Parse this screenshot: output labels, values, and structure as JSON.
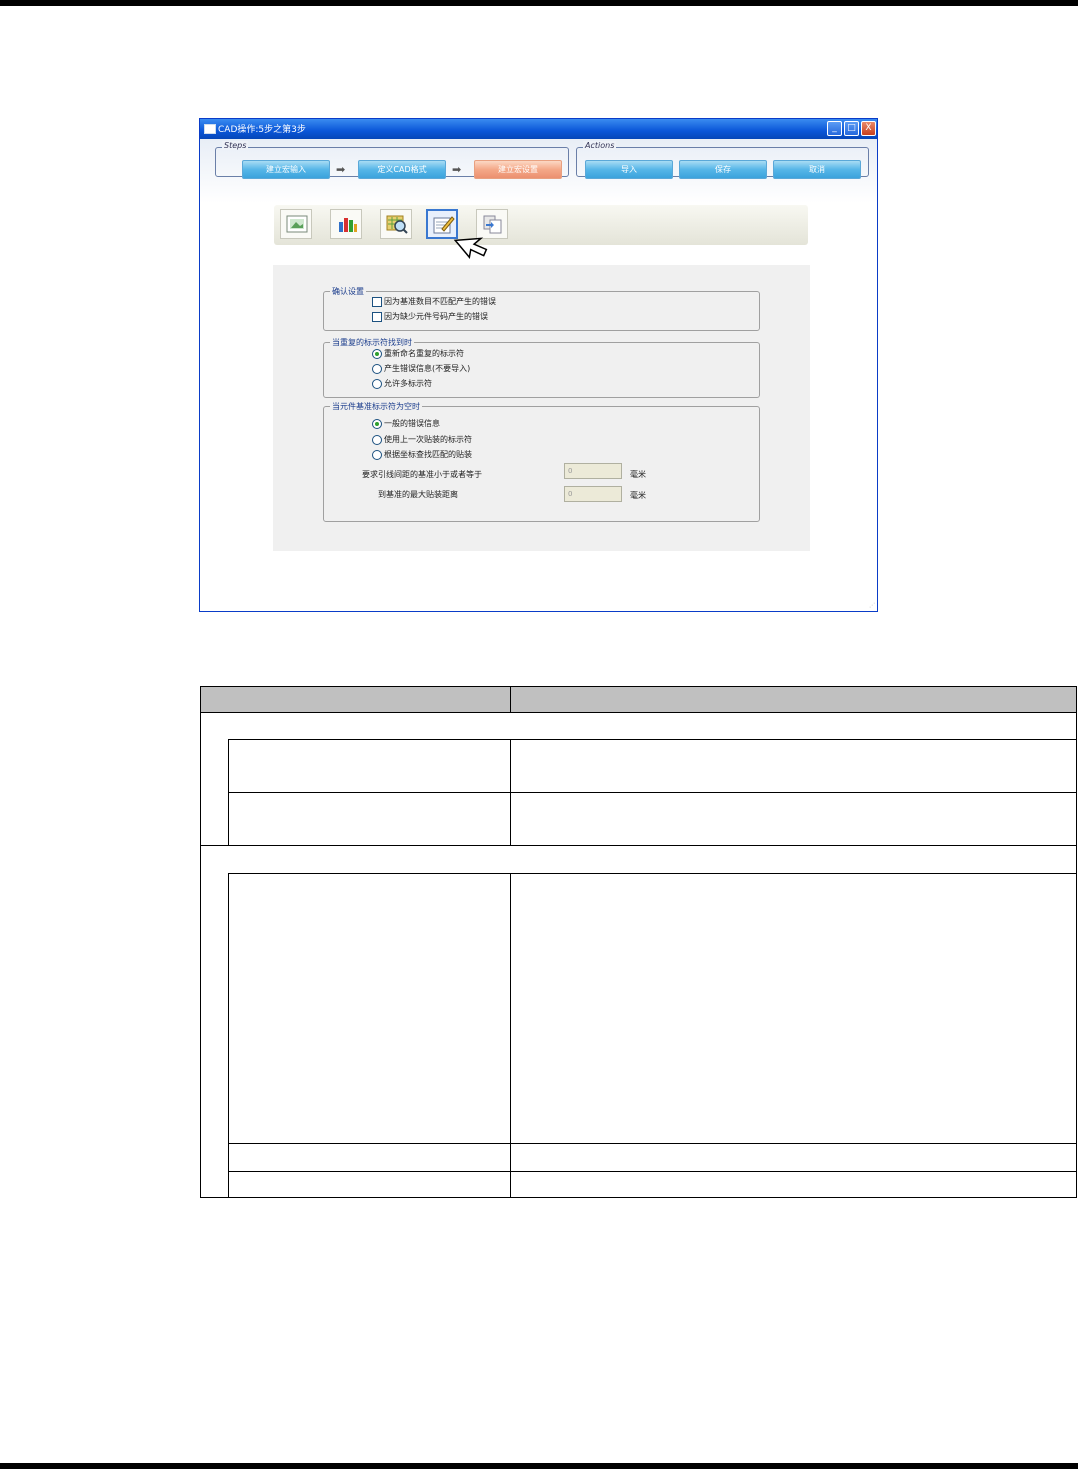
{
  "window": {
    "title": "CAD操作:5步之第3步",
    "controls": [
      "_",
      "□",
      "X"
    ]
  },
  "steps": {
    "legend": "Steps",
    "items": [
      "建立宏输入",
      "定义CAD格式",
      "建立宏设置"
    ],
    "active_index": 2
  },
  "actions": {
    "legend": "Actions",
    "items": [
      "导入",
      "保存",
      "取消"
    ]
  },
  "toolbar": {
    "tools": [
      "image-tool-icon",
      "chart-tool-icon",
      "map-search-tool-icon",
      "edit-settings-tool-icon",
      "copy-tool-icon"
    ],
    "selected_index": 3
  },
  "confirm_settings": {
    "legend": "确认设置",
    "options": [
      {
        "label": "因为基准数目不匹配产生的错误",
        "checked": false
      },
      {
        "label": "因为缺少元件号码产生的错误",
        "checked": false
      }
    ]
  },
  "duplicate_identifier": {
    "legend": "当重复的标示符找到时",
    "options": [
      {
        "label": "重新命名重复的标示符",
        "selected": true
      },
      {
        "label": "产生错误信息(不要导入)",
        "selected": false
      },
      {
        "label": "允许多标示符",
        "selected": false
      }
    ]
  },
  "empty_identifier": {
    "legend": "当元件基准标示符为空时",
    "options": [
      {
        "label": "一般的错误信息",
        "selected": true
      },
      {
        "label": "使用上一次贴装的标示符",
        "selected": false
      },
      {
        "label": "根据坐标查找匹配的贴装",
        "selected": false
      }
    ],
    "fields": [
      {
        "label": "要求引线间距的基准小于或者等于",
        "value": "0",
        "unit": "毫米"
      },
      {
        "label": "到基准的最大贴装距离",
        "value": "0",
        "unit": "毫米"
      }
    ]
  }
}
